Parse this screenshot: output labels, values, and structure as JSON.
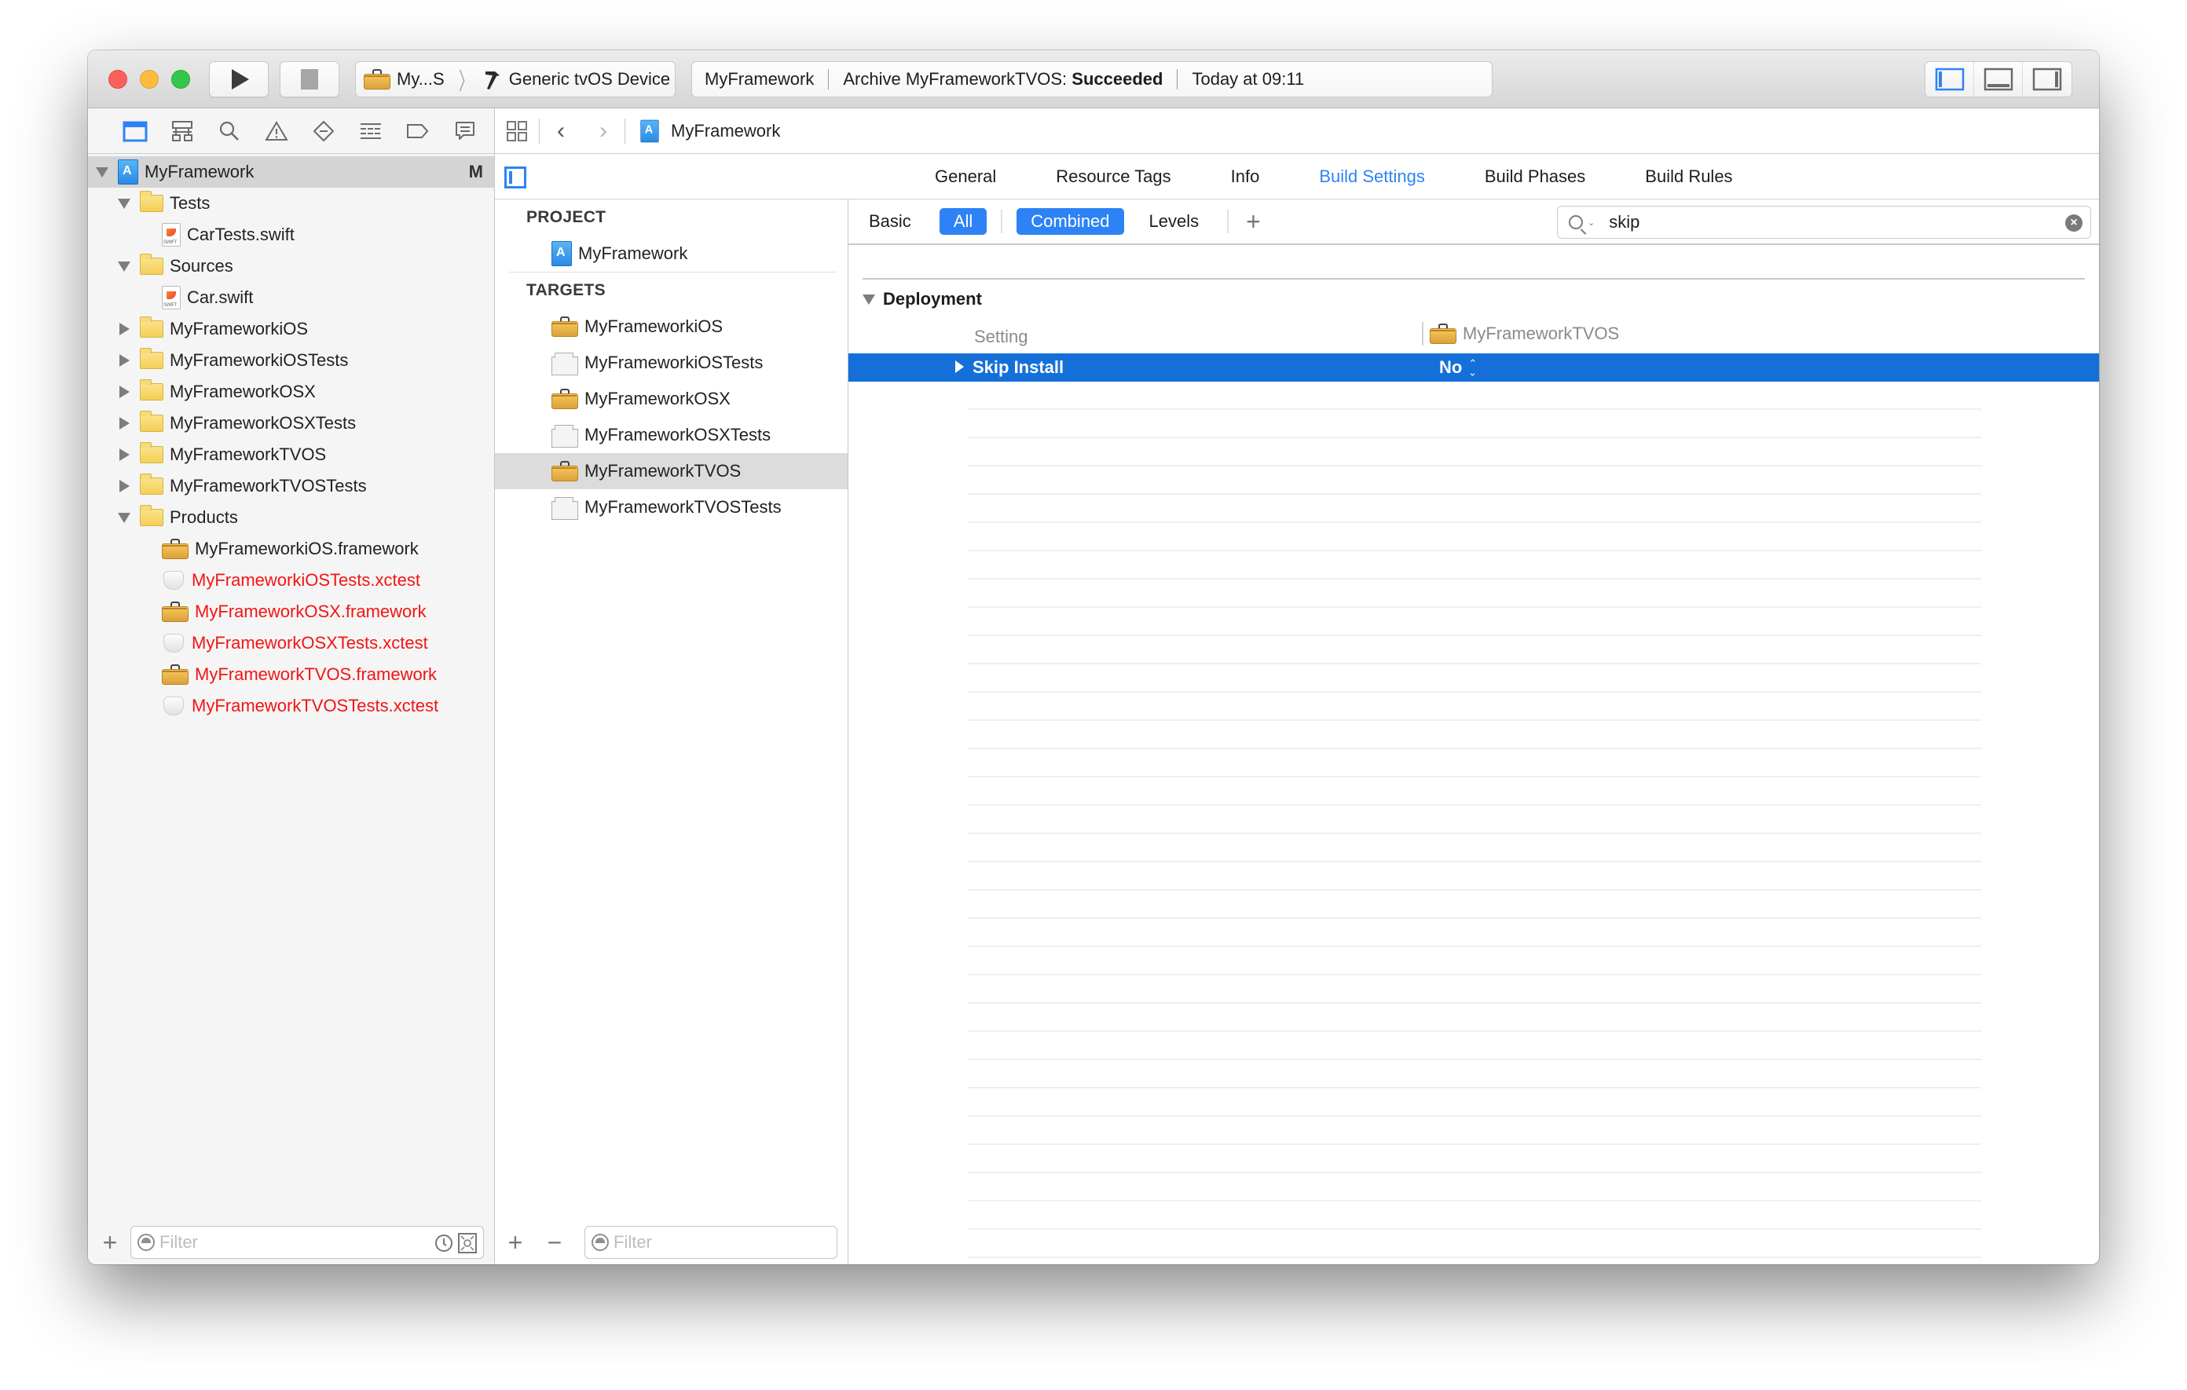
{
  "toolbar": {
    "scheme_name": "My...S",
    "destination": "Generic tvOS Device",
    "activity": {
      "project": "MyFramework",
      "status_prefix": "Archive MyFrameworkTVOS:",
      "status_result": "Succeeded",
      "time": "Today at 09:11"
    },
    "buttons": [
      "run",
      "stop"
    ],
    "editor_modes": [
      {
        "name": "standard-editor",
        "active": true
      },
      {
        "name": "assistant-editor",
        "active": false
      },
      {
        "name": "version-editor",
        "active": false
      }
    ],
    "view_toggles": [
      {
        "name": "navigator",
        "active": true
      },
      {
        "name": "debug-area",
        "active": false
      },
      {
        "name": "utilities",
        "active": false
      }
    ]
  },
  "navigator": {
    "tabs": [
      "project-navigator",
      "symbol-navigator",
      "find-navigator",
      "issue-navigator",
      "test-navigator",
      "debug-navigator",
      "breakpoint-navigator",
      "report-navigator"
    ],
    "tree": [
      {
        "label": "MyFramework",
        "icon": "project",
        "level": 0,
        "expanded": true,
        "selected": true,
        "badge": "M"
      },
      {
        "label": "Tests",
        "icon": "folder",
        "level": 1,
        "expanded": true
      },
      {
        "label": "CarTests.swift",
        "icon": "swift",
        "level": 2
      },
      {
        "label": "Sources",
        "icon": "folder",
        "level": 1,
        "expanded": true
      },
      {
        "label": "Car.swift",
        "icon": "swift",
        "level": 2
      },
      {
        "label": "MyFrameworkiOS",
        "icon": "folder",
        "level": 1,
        "expanded": false
      },
      {
        "label": "MyFrameworkiOSTests",
        "icon": "folder",
        "level": 1,
        "expanded": false
      },
      {
        "label": "MyFrameworkOSX",
        "icon": "folder",
        "level": 1,
        "expanded": false
      },
      {
        "label": "MyFrameworkOSXTests",
        "icon": "folder",
        "level": 1,
        "expanded": false
      },
      {
        "label": "MyFrameworkTVOS",
        "icon": "folder",
        "level": 1,
        "expanded": false
      },
      {
        "label": "MyFrameworkTVOSTests",
        "icon": "folder",
        "level": 1,
        "expanded": false
      },
      {
        "label": "Products",
        "icon": "folder",
        "level": 1,
        "expanded": true
      },
      {
        "label": "MyFrameworkiOS.framework",
        "icon": "toolbox",
        "level": 2
      },
      {
        "label": "MyFrameworkiOSTests.xctest",
        "icon": "xctest",
        "level": 2,
        "missing": true
      },
      {
        "label": "MyFrameworkOSX.framework",
        "icon": "toolbox",
        "level": 2,
        "missing": true
      },
      {
        "label": "MyFrameworkOSXTests.xctest",
        "icon": "xctest",
        "level": 2,
        "missing": true
      },
      {
        "label": "MyFrameworkTVOS.framework",
        "icon": "toolbox",
        "level": 2,
        "missing": true
      },
      {
        "label": "MyFrameworkTVOSTests.xctest",
        "icon": "xctest",
        "level": 2,
        "missing": true
      }
    ],
    "filter_placeholder": "Filter"
  },
  "jumpbar": {
    "title": "MyFramework"
  },
  "editor_tabs": [
    {
      "label": "General",
      "active": false
    },
    {
      "label": "Resource Tags",
      "active": false
    },
    {
      "label": "Info",
      "active": false
    },
    {
      "label": "Build Settings",
      "active": true
    },
    {
      "label": "Build Phases",
      "active": false
    },
    {
      "label": "Build Rules",
      "active": false
    }
  ],
  "target_list": {
    "project_header": "PROJECT",
    "project": "MyFramework",
    "targets_header": "TARGETS",
    "targets": [
      {
        "label": "MyFrameworkiOS",
        "icon": "toolbox",
        "selected": false
      },
      {
        "label": "MyFrameworkiOSTests",
        "icon": "bundle",
        "selected": false
      },
      {
        "label": "MyFrameworkOSX",
        "icon": "toolbox",
        "selected": false
      },
      {
        "label": "MyFrameworkOSXTests",
        "icon": "bundle",
        "selected": false
      },
      {
        "label": "MyFrameworkTVOS",
        "icon": "toolbox",
        "selected": true
      },
      {
        "label": "MyFrameworkTVOSTests",
        "icon": "bundle",
        "selected": false
      }
    ],
    "filter_placeholder": "Filter"
  },
  "build_settings": {
    "filter": {
      "basic": "Basic",
      "all": "All",
      "combined": "Combined",
      "levels": "Levels",
      "selected_scope": "All",
      "selected_view": "Combined"
    },
    "search_value": "skip",
    "section": "Deployment",
    "column_setting": "Setting",
    "column_target": "MyFrameworkTVOS",
    "rows": [
      {
        "name": "Skip Install",
        "value": "No",
        "selected": true
      }
    ]
  },
  "colors": {
    "accent": "#2d83f5",
    "selection": "#1470d8",
    "missing_file": "#f31414"
  }
}
